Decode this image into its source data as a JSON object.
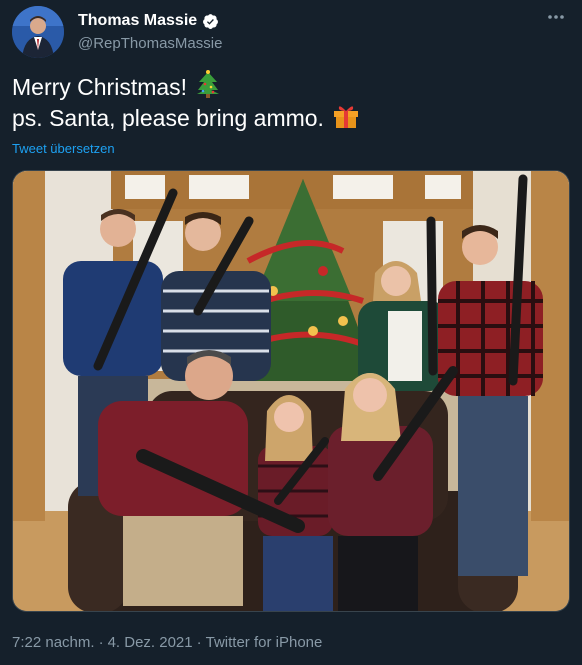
{
  "user": {
    "display_name": "Thomas Massie",
    "handle": "@RepThomasMassie",
    "verified_icon": "verified-badge-icon"
  },
  "tweet": {
    "line1": "Merry Christmas!",
    "line2": "ps. Santa, please bring ammo.",
    "line1_emoji": "christmas-tree-icon",
    "line2_emoji": "wrapped-gift-icon",
    "translate_label": "Tweet übersetzen"
  },
  "meta": {
    "time": "7:22 nachm.",
    "separator": "·",
    "date": "4. Dez. 2021",
    "source": "Twitter for iPhone"
  },
  "colors": {
    "background": "#15202b",
    "link": "#1da1f2",
    "secondary_text": "#8899a6",
    "verified_badge": "#ffffff"
  }
}
